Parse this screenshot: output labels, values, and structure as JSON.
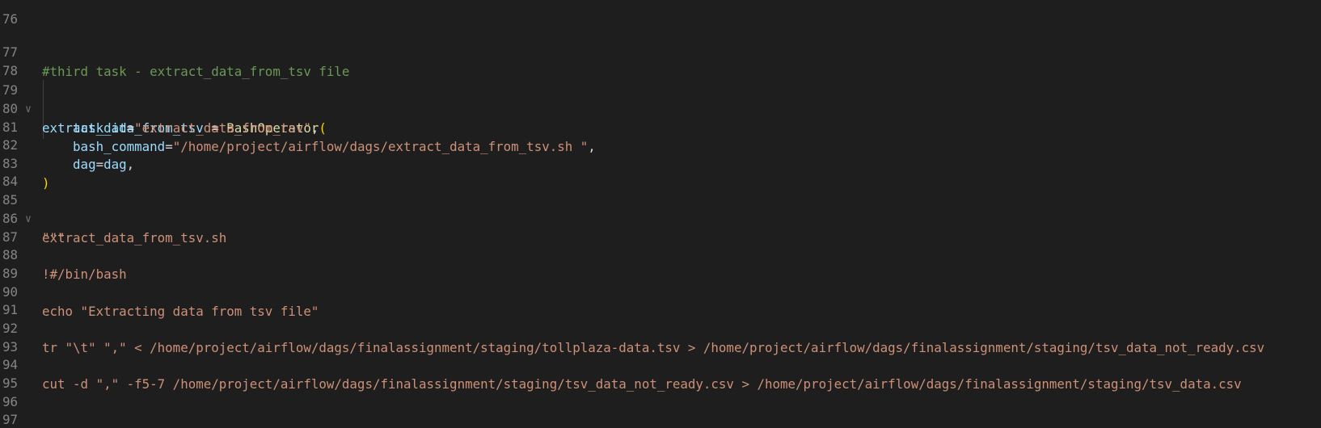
{
  "editor": {
    "lines": [
      {
        "num": "76"
      },
      {
        "num": "77",
        "comment": "#third task - extract_data_from_tsv file"
      },
      {
        "num": "78"
      },
      {
        "num": "79",
        "fold": "∨",
        "var": "extract_data_from_tsv",
        "eq": " = ",
        "fn": "BashOperator",
        "bracket": "("
      },
      {
        "num": "80",
        "indent": "    ",
        "param": "task_id",
        "eq": "=",
        "str": "\"extract_data_from_tsv\"",
        "tail": ","
      },
      {
        "num": "81",
        "indent": "    ",
        "param": "bash_command",
        "eq": "=",
        "str": "\"/home/project/airflow/dags/extract_data_from_tsv.sh \"",
        "tail": ","
      },
      {
        "num": "82",
        "indent": "    ",
        "param": "dag",
        "eq": "=",
        "value": "dag",
        "tail": ","
      },
      {
        "num": "83",
        "bracket": ")"
      },
      {
        "num": "84"
      },
      {
        "num": "85",
        "fold": "∨",
        "str": "\"\"\""
      },
      {
        "num": "86",
        "str": "extract_data_from_tsv.sh"
      },
      {
        "num": "87"
      },
      {
        "num": "88",
        "str": "!#/bin/bash"
      },
      {
        "num": "89"
      },
      {
        "num": "90",
        "str": "echo \"Extracting data from tsv file\""
      },
      {
        "num": "91"
      },
      {
        "num": "92",
        "str": "tr \"\\t\" \",\" < /home/project/airflow/dags/finalassignment/staging/tollplaza-data.tsv > /home/project/airflow/dags/finalassignment/staging/tsv_data_not_ready.csv"
      },
      {
        "num": "93"
      },
      {
        "num": "94",
        "str": "cut -d \",\" -f5-7 /home/project/airflow/dags/finalassignment/staging/tsv_data_not_ready.csv > /home/project/airflow/dags/finalassignment/staging/tsv_data.csv"
      },
      {
        "num": "95"
      },
      {
        "num": "96"
      },
      {
        "num": "97",
        "str": "\"\"\""
      }
    ]
  }
}
